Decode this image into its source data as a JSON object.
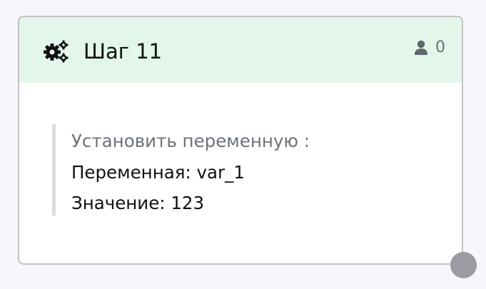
{
  "step": {
    "icon": "gears-icon",
    "title": "Шаг 11",
    "user_icon": "user-icon",
    "user_count": "0"
  },
  "action": {
    "title": "Установить переменную :",
    "variable_line": "Переменная: var_1",
    "value_line": "Значение: 123"
  },
  "colors": {
    "header_bg": "#e2f6e9",
    "muted_text": "#6c7278",
    "border": "#c2c2c4"
  }
}
